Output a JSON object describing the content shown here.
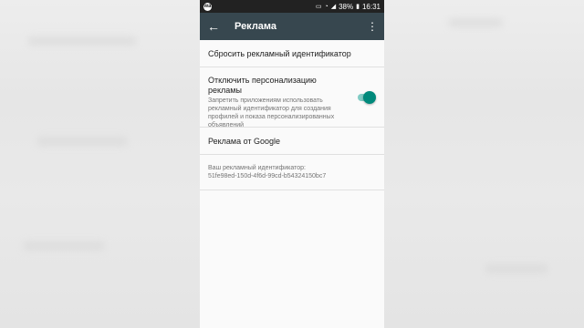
{
  "statusbar": {
    "battery_percent": "38%",
    "time": "16:31",
    "app_badge": "wa"
  },
  "toolbar": {
    "title": "Реклама"
  },
  "settings": {
    "reset_label": "Сбросить рекламный идентификатор",
    "personalization": {
      "title": "Отключить персонализацию рекламы",
      "description": "Запретить приложениям использовать рекламный идентификатор для создания профилей и показа персонализированных объявлений",
      "enabled": true
    },
    "google_ads_label": "Реклама от Google",
    "ad_id_label": "Ваш рекламный идентификатор:",
    "ad_id_value": "51fe98ed-150d-4f6d-99cd-b54324150bc7"
  },
  "colors": {
    "toolbar": "#37474f",
    "accent": "#00897b",
    "accent_track": "#80cbc4"
  }
}
